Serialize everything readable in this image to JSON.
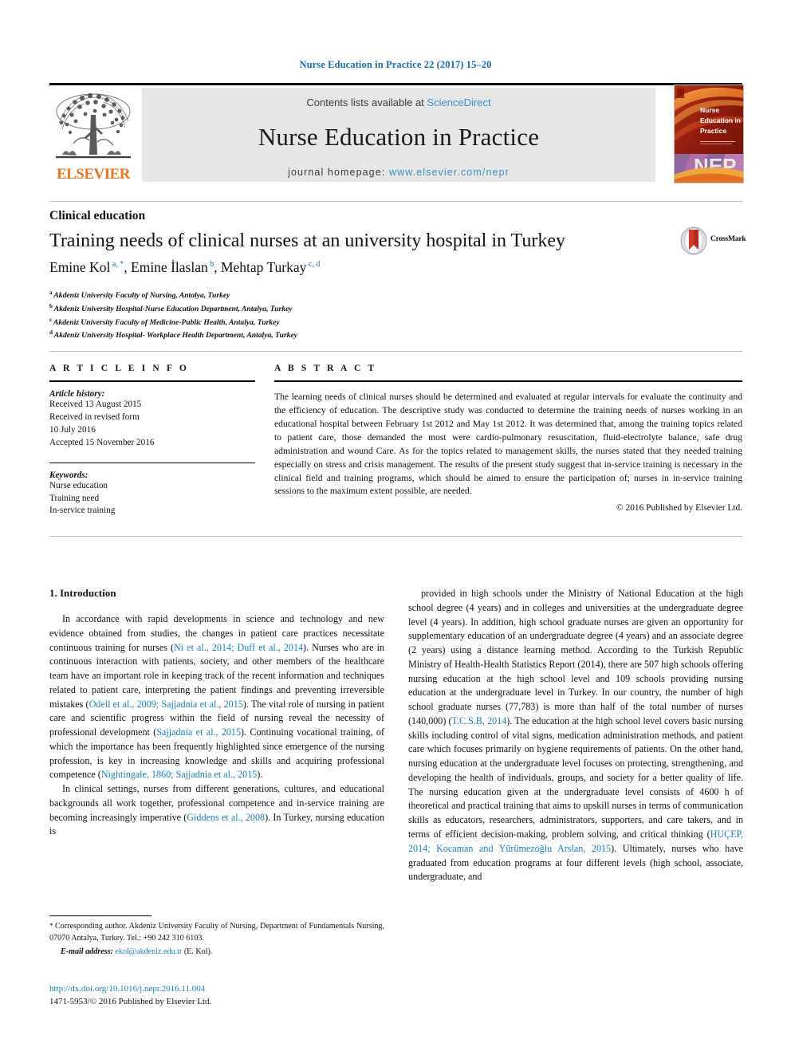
{
  "running_head": "Nurse Education in Practice 22 (2017) 15–20",
  "masthead": {
    "contents_prefix": "Contents lists available at ",
    "sciencedirect": "ScienceDirect",
    "journal_title": "Nurse Education in Practice",
    "homepage_prefix": "journal homepage: ",
    "homepage_url": "www.elsevier.com/nepr",
    "publisher_logo_text": "ELSEVIER",
    "cover_line1": "Nurse",
    "cover_line2": "Education in",
    "cover_line3": "Practice",
    "cover_acronym": "NEP"
  },
  "article": {
    "section_label": "Clinical education",
    "title": "Training needs of clinical nurses at an university hospital in Turkey",
    "crossmark_label": "CrossMark",
    "authors": [
      {
        "name": "Emine Kol",
        "marks": "a, *"
      },
      {
        "name": "Emine İlaslan",
        "marks": "b"
      },
      {
        "name": "Mehtap Turkay",
        "marks": "c, d"
      }
    ],
    "affiliations": [
      {
        "mark": "a",
        "text": "Akdeniz University Faculty of Nursing, Antalya, Turkey"
      },
      {
        "mark": "b",
        "text": "Akdeniz University Hospital-Nurse Education Department, Antalya, Turkey"
      },
      {
        "mark": "c",
        "text": "Akdeniz University Faculty of Medicine-Public Health, Antalya, Turkey"
      },
      {
        "mark": "d",
        "text": "Akdeniz University Hospital- Workplace Health Department, Antalya, Turkey"
      }
    ]
  },
  "article_info": {
    "heading": "A R T I C L E  I N F O",
    "history_label": "Article history:",
    "history": [
      "Received 13 August 2015",
      "Received in revised form",
      "10 July 2016",
      "Accepted 15 November 2016"
    ],
    "keywords_label": "Keywords:",
    "keywords": [
      "Nurse education",
      "Training need",
      "In-service training"
    ]
  },
  "abstract": {
    "heading": "A B S T R A C T",
    "text": "The learning needs of clinical nurses should be determined and evaluated at regular intervals for evaluate the continuity and the efficiency of education. The descriptive study was conducted to determine the training needs of nurses working in an educational hospital between February 1st 2012 and May 1st 2012. It was determined that, among the training topics related to patient care, those demanded the most were cardio-pulmonary resuscitation, fluid-electrolyte balance, safe drug administration and wound Care. As for the topics related to management skills, the nurses stated that they needed training especially on stress and crisis management. The results of the present study suggest that in-service training is necessary in the clinical field and training programs, which should be aimed to ensure the participation of; nurses in in-service training sessions to the maximum extent possible, are needed.",
    "copyright": "© 2016 Published by Elsevier Ltd."
  },
  "body": {
    "intro_heading": "1. Introduction",
    "left_paragraphs": [
      {
        "runs": [
          {
            "t": "In accordance with rapid developments in science and technology and new evidence obtained from studies, the changes in patient care practices necessitate continuous training for nurses ("
          },
          {
            "t": "Ni et al., 2014; Duff et al., 2014",
            "ref": true
          },
          {
            "t": "). Nurses who are in continuous interaction with patients, society, and other members of the healthcare team have an important role in keeping track of the recent information and techniques related to patient care, interpreting the patient findings and preventing irreversible mistakes ("
          },
          {
            "t": "Odell et al., 2009; Sajjadnia et al., 2015",
            "ref": true
          },
          {
            "t": "). The vital role of nursing in patient care and scientific progress within the field of nursing reveal the necessity of professional development ("
          },
          {
            "t": "Sajjadnia et al., 2015",
            "ref": true
          },
          {
            "t": "). Continuing vocational training, of which the importance has been frequently highlighted since emergence of the nursing profession, is key in increasing knowledge and skills and acquiring professional competence ("
          },
          {
            "t": "Nightingale, 1860; Sajjadnia et al., 2015",
            "ref": true
          },
          {
            "t": ")."
          }
        ]
      },
      {
        "runs": [
          {
            "t": "In clinical settings, nurses from different generations, cultures, and educational backgrounds all work together, professional competence and in-service training are becoming increasingly imperative ("
          },
          {
            "t": "Giddens et al., 2008",
            "ref": true
          },
          {
            "t": "). In Turkey, nursing education is"
          }
        ]
      }
    ],
    "right_paragraphs": [
      {
        "runs": [
          {
            "t": "provided in high schools under the Ministry of National Education at the high school degree (4 years) and in colleges and universities at the undergraduate degree level (4 years). In addition, high school graduate nurses are given an opportunity for supplementary education of an undergraduate degree (4 years) and an associate degree (2 years) using a distance learning method. According to the Turkish Republic Ministry of Health-Health Statistics Report (2014), there are 507 high schools offering nursing education at the high school level and 109 schools providing nursing education at the undergraduate level in Turkey. In our country, the number of high school graduate nurses (77,783) is more than half of the total number of nurses (140,000) ("
          },
          {
            "t": "T.C.S.B, 2014",
            "ref": true
          },
          {
            "t": "). The education at the high school level covers basic nursing skills including control of vital signs, medication administration methods, and patient care which focuses primarily on hygiene requirements of patients. On the other hand, nursing education at the undergraduate level focuses on protecting, strengthening, and developing the health of individuals, groups, and society for a better quality of life. The nursing education given at the undergraduate level consists of 4600 h of theoretical and practical training that aims to upskill nurses in terms of communication skills as educators, researchers, administrators, supporters, and care takers, and in terms of efficient decision-making, problem solving, and critical thinking ("
          },
          {
            "t": "HUÇEP, 2014; Kocaman and Yürümezoğlu Arslan, 2015",
            "ref": true
          },
          {
            "t": "). Ultimately, nurses who have graduated from education programs at four different levels (high school, associate, undergraduate, and"
          }
        ]
      }
    ]
  },
  "footnotes": {
    "corresponding": "Corresponding author. Akdeniz University Faculty of Nursing, Department of Fundamentals Nursing, 07070 Antalya, Turkey. Tel.: +90 242 310 6103.",
    "email_label": "E-mail address:",
    "email": "ekol@akdeniz.edu.tr",
    "email_suffix": "(E. Kol).",
    "doi": "http://dx.doi.org/10.1016/j.nepr.2016.11.004",
    "issn_line": "1471-5953/© 2016 Published by Elsevier Ltd."
  },
  "colors": {
    "link_blue": "#1b7fb8",
    "header_blue": "#1b6ca8",
    "sciencedirect_blue": "#3a8fc4",
    "elsevier_orange": "#e87722",
    "band_gray": "#e6e6e6"
  }
}
